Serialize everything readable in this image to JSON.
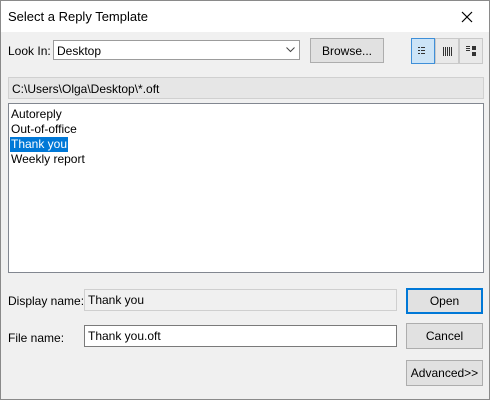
{
  "window": {
    "title": "Select a Reply Template"
  },
  "look_in": {
    "label": "Look In:",
    "value": "Desktop"
  },
  "toolbar": {
    "browse_label": "Browse...",
    "views": [
      "list-view-icon",
      "details-view-icon",
      "properties-view-icon"
    ],
    "active_view": "list-view-icon"
  },
  "path": "C:\\Users\\Olga\\Desktop\\*.oft",
  "files": [
    {
      "name": "Autoreply",
      "selected": false
    },
    {
      "name": "Out-of-office",
      "selected": false
    },
    {
      "name": "Thank you",
      "selected": true
    },
    {
      "name": "Weekly report",
      "selected": false
    }
  ],
  "display_name": {
    "label": "Display name:",
    "value": "Thank you"
  },
  "file_name": {
    "label": "File name:",
    "value": "Thank you.oft"
  },
  "buttons": {
    "open": "Open",
    "cancel": "Cancel",
    "advanced": "Advanced>>"
  },
  "colors": {
    "accent": "#0078d7",
    "selection_text": "#ffffff"
  }
}
